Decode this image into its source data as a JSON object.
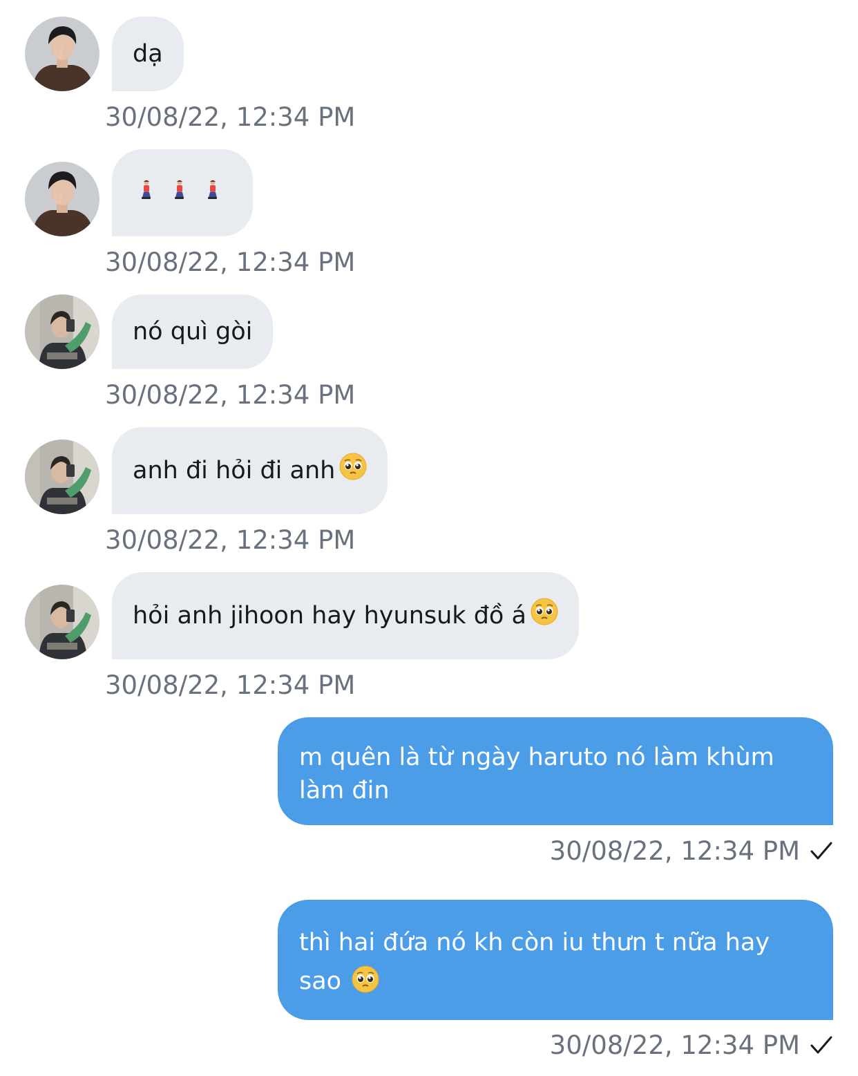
{
  "messages": [
    {
      "side": "in",
      "avatar": "avatar-a",
      "text": "dạ",
      "time": "30/08/22, 12:34 PM"
    },
    {
      "side": "in",
      "avatar": "avatar-a",
      "emoji": [
        "person-kneeling-icon",
        "person-kneeling-icon",
        "person-kneeling-icon"
      ],
      "time": "30/08/22, 12:34 PM"
    },
    {
      "side": "in",
      "avatar": "avatar-b",
      "text": "nó quì gòi",
      "time": "30/08/22, 12:34 PM"
    },
    {
      "side": "in",
      "avatar": "avatar-b",
      "text": "anh đi hỏi đi anh",
      "emoji": "pleading-face-icon",
      "time": "30/08/22, 12:34 PM"
    },
    {
      "side": "in",
      "avatar": "avatar-b",
      "text": "hỏi anh jihoon hay hyunsuk đồ á",
      "emoji": "pleading-face-icon",
      "time": "30/08/22, 12:34 PM"
    },
    {
      "side": "out",
      "text_line1": "m quên là từ ngày haruto nó làm khùm",
      "text_line2": "làm đin",
      "time": "30/08/22, 12:34 PM",
      "status_icon": "checkmark-icon"
    },
    {
      "side": "out",
      "text_line1": "thì hai đứa nó kh còn iu thưn t nữa hay",
      "text_line2": "sao",
      "emoji": "pleading-face-icon",
      "time": "30/08/22, 12:34 PM",
      "status_icon": "checkmark-icon"
    }
  ],
  "colors": {
    "incoming_bubble": "#e8ebef",
    "outgoing_bubble": "#4c9de8",
    "timestamp": "#68717d"
  }
}
